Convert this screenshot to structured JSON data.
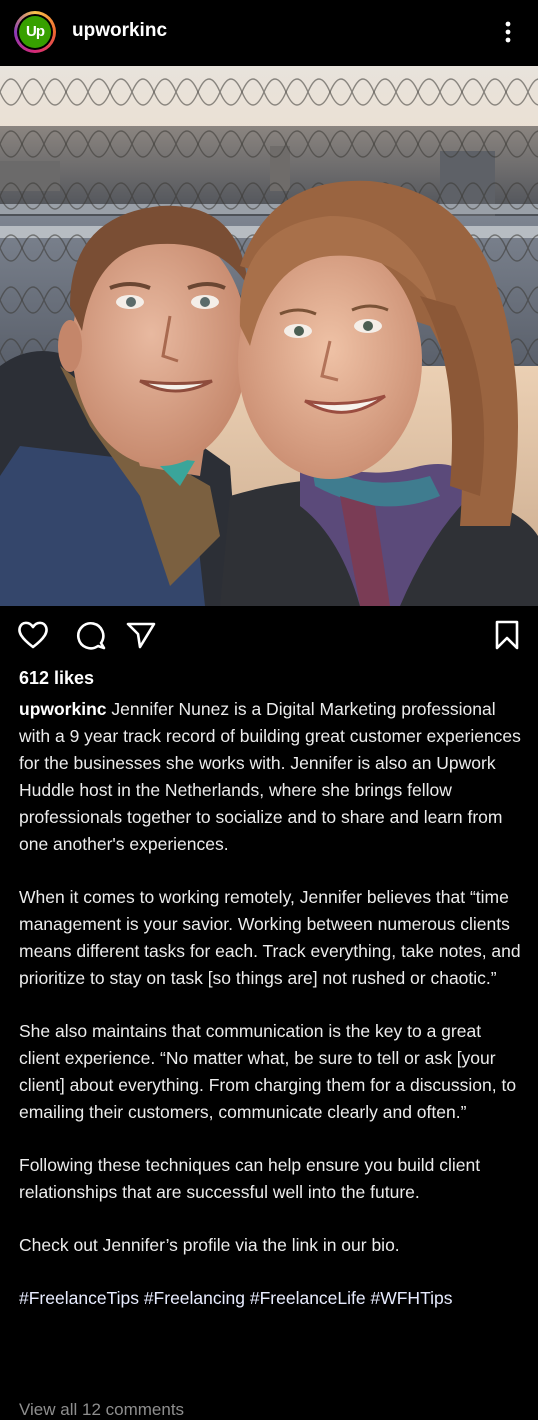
{
  "header": {
    "username": "upworkinc",
    "avatar_text": "Up",
    "more_icon": "more-vertical-icon"
  },
  "post": {
    "image_alt": "Selfie of a man and a woman on an observation deck above a city skyline at sunset",
    "likes": "612 likes",
    "caption_user": "upworkinc",
    "caption_paragraphs": [
      "Jennifer Nunez is a Digital Marketing professional with a 9 year track record of building great customer experiences for the businesses she works with. Jennifer is also an Upwork Huddle host in the Netherlands, where she brings fellow professionals together to socialize and to share and learn from one another's experiences.",
      "When it comes to working remotely, Jennifer believes that “time management is your savior. Working between numerous clients means different tasks for each. Track everything, take notes, and prioritize to stay on task [so things are] not rushed or chaotic.”",
      "She also maintains that communication is the key to a great client experience. “No matter what, be sure to tell or ask [your client] about everything. From charging them for a discussion, to emailing their customers, communicate clearly and often.”",
      "Following these techniques can help ensure you build client relationships that are successful well into the future.",
      "Check out Jennifer’s profile via the link in our bio."
    ],
    "hashtags": "#FreelanceTips #Freelancing #FreelanceLife #WFHTips",
    "view_comments": "View all 12 comments"
  },
  "icons": {
    "like": "heart-icon",
    "comment": "comment-icon",
    "share": "send-icon",
    "save": "bookmark-icon"
  },
  "colors": {
    "background": "#000000",
    "text": "#ececec",
    "brand": "#37a000"
  }
}
